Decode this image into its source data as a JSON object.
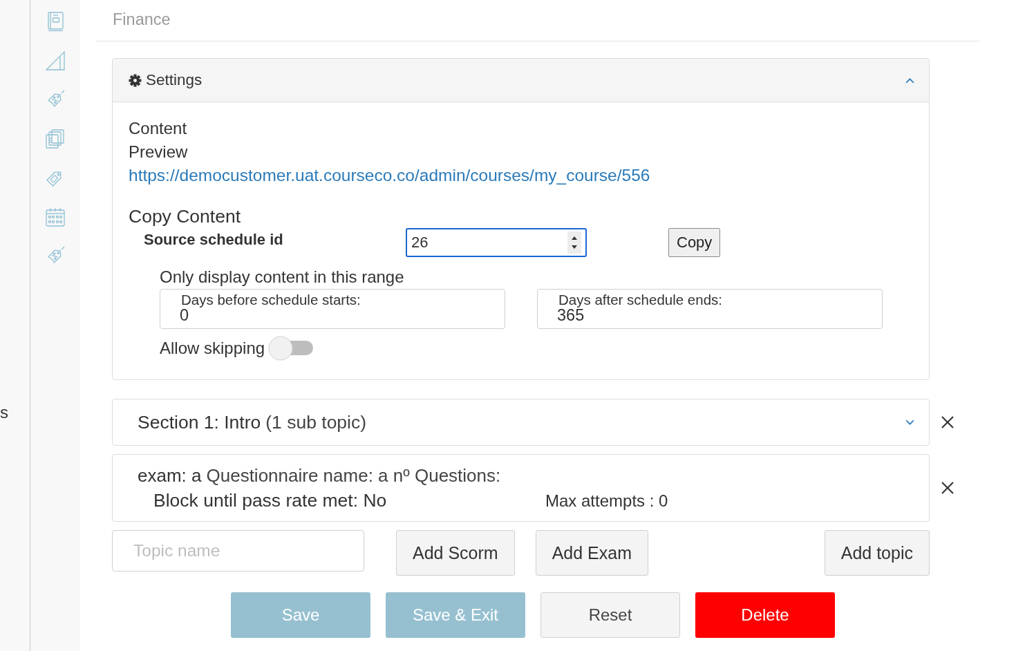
{
  "cut_off_text": "s",
  "page_title": "Finance",
  "settings_panel": {
    "title": "Settings",
    "expanded": true,
    "content_label": "Content",
    "preview_label": "Preview",
    "preview_link": "https://democustomer.uat.courseco.co/admin/courses/my_course/556",
    "copy_content": {
      "heading": "Copy Content",
      "source_label": "Source schedule id",
      "source_value": "26",
      "focused": true,
      "copy_button": "Copy"
    },
    "range": {
      "heading": "Only display content in this range",
      "fields": [
        {
          "label": "Days before schedule starts:",
          "value": "0"
        },
        {
          "label": "Days after schedule ends:",
          "value": "365"
        }
      ]
    },
    "allow_skipping": {
      "label": "Allow skipping",
      "on": false
    }
  },
  "sections": [
    {
      "title": "Section 1: Intro",
      "count": "(1 sub topic)",
      "expanded": false
    }
  ],
  "topics": [
    {
      "title": "exam: a",
      "details": "Questionnaire name: a nº Questions:",
      "block_rule": "Block until pass rate met: No",
      "max_attempts": "Max attempts : 0"
    }
  ],
  "add_topic": {
    "placeholder": "Topic name",
    "buttons": [
      "Add Scorm",
      "Add Exam",
      "Add topic"
    ]
  },
  "actions": [
    {
      "label": "Save",
      "kind": "primary"
    },
    {
      "label": "Save & Exit",
      "kind": "primary"
    },
    {
      "label": "Reset",
      "kind": "default"
    },
    {
      "label": "Delete",
      "kind": "danger"
    }
  ]
}
